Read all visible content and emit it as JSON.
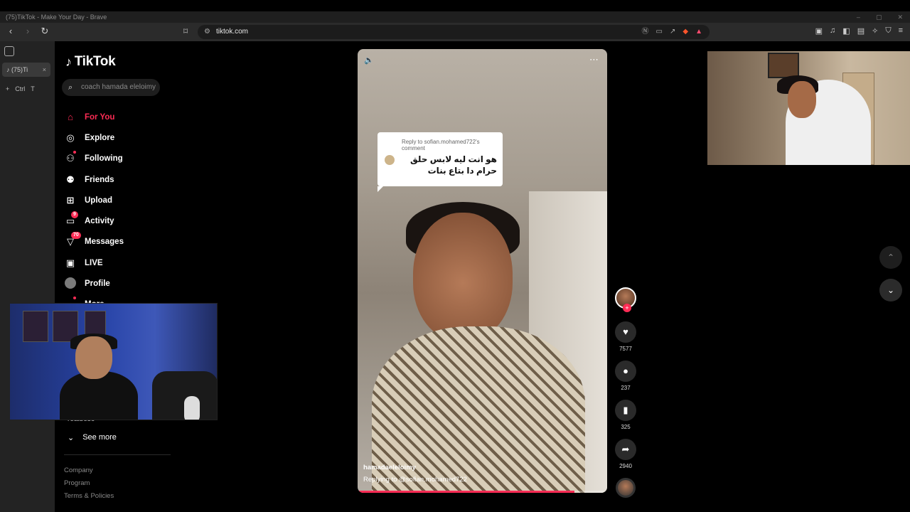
{
  "browser": {
    "window_title": "(75)TikTok - Make Your Day - Brave",
    "url": "tiktok.com",
    "tab_label": "(75)Ti",
    "new_tab_shortcut_ctrl": "Ctrl",
    "new_tab_shortcut_key": "T"
  },
  "tiktok": {
    "logo_text": "TikTok",
    "search_placeholder": "coach hamada eleloimy",
    "nav": [
      {
        "label": "For You",
        "icon": "home-icon",
        "active": true
      },
      {
        "label": "Explore",
        "icon": "compass-icon"
      },
      {
        "label": "Following",
        "icon": "following-icon"
      },
      {
        "label": "Friends",
        "icon": "friends-icon"
      },
      {
        "label": "Upload",
        "icon": "upload-icon"
      },
      {
        "label": "Activity",
        "icon": "activity-icon",
        "badge": "9"
      },
      {
        "label": "Messages",
        "icon": "messages-icon",
        "badge": "70"
      },
      {
        "label": "LIVE",
        "icon": "live-icon"
      },
      {
        "label": "Profile",
        "icon": "profile-icon"
      },
      {
        "label": "More",
        "icon": "more-icon"
      }
    ],
    "following_account_partial": "realbeso",
    "see_more": "See more",
    "footer_links": [
      "Company",
      "Program",
      "Terms & Policies"
    ],
    "video": {
      "reply_header": "Reply to sofian.mohamed722's comment",
      "reply_text_line1": "هو انت ليه لابس حلق",
      "reply_text_line2": "حرام دا بتاع بنات",
      "username": "hamadaeleloimy",
      "description": "Replying to @sofian.mohamed722",
      "progress": 0.87
    },
    "actions": {
      "likes": "7577",
      "comments": "237",
      "saves": "325",
      "shares": "2940"
    }
  },
  "colors": {
    "accent": "#fe2c55",
    "background": "#000000"
  }
}
